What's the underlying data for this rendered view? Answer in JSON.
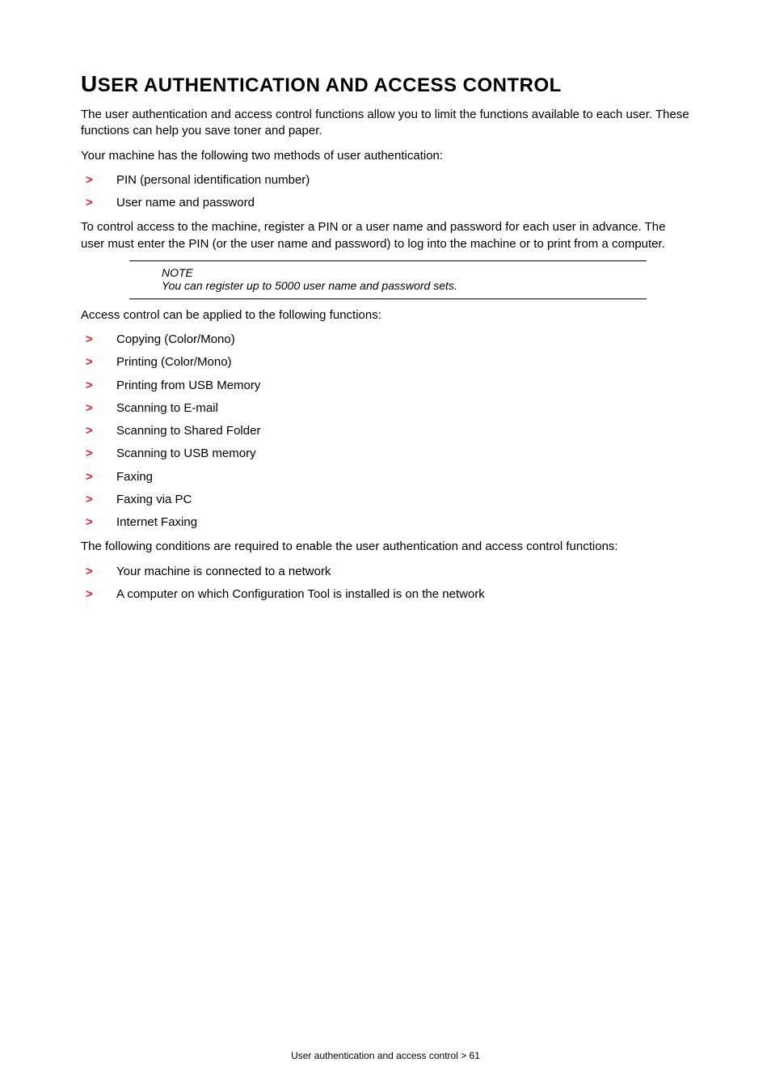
{
  "heading": "User authentication and access control",
  "p1": "The user authentication and access control functions allow you to limit the functions available to each user. These functions can help you save toner and paper.",
  "p2": "Your machine has the following two methods of user authentication:",
  "list1": [
    "PIN (personal identification number)",
    "User name and password"
  ],
  "p3": "To control access to the machine, register a PIN or a user name and password for each user in advance. The user must enter the PIN (or the user name and password) to log into the machine or to print from a computer.",
  "note": {
    "title": "NOTE",
    "text": "You can register up to 5000 user name and password sets."
  },
  "p4": "Access control can be applied to the following functions:",
  "list2": [
    "Copying (Color/Mono)",
    "Printing (Color/Mono)",
    "Printing from USB Memory",
    "Scanning to E-mail",
    "Scanning to Shared Folder",
    "Scanning to USB memory",
    "Faxing",
    "Faxing via PC",
    "Internet Faxing"
  ],
  "p5": "The following conditions are required to enable the user authentication and access control functions:",
  "list3": [
    "Your machine is connected to a network",
    "A computer on which Configuration Tool is installed is on the network"
  ],
  "footer": "User authentication and access control > 61"
}
